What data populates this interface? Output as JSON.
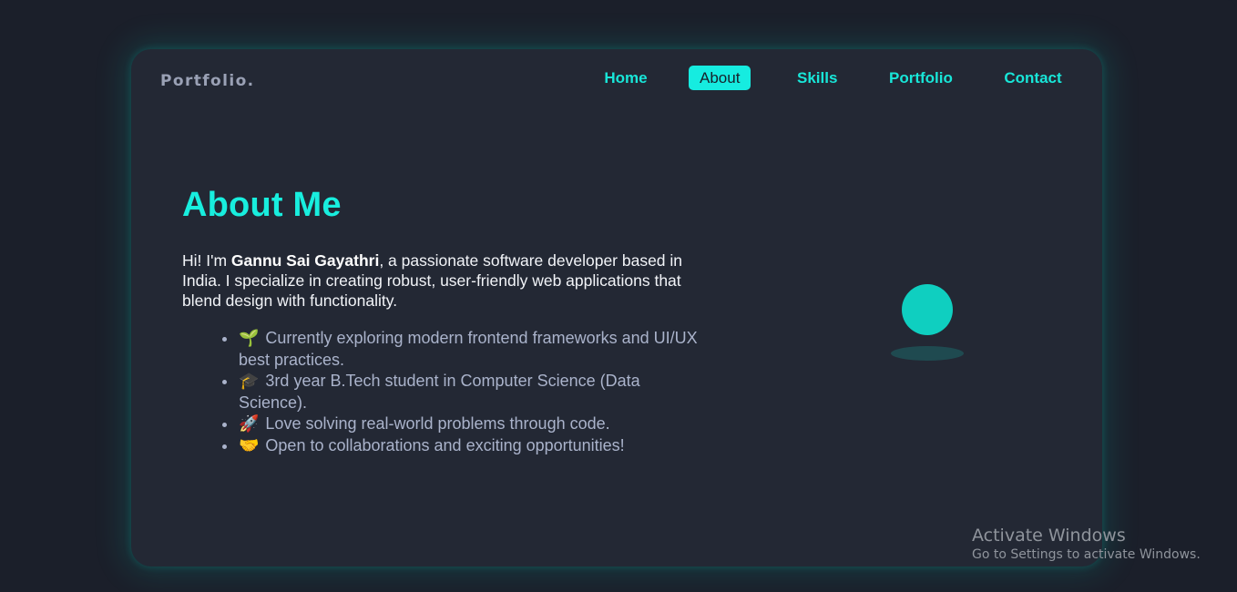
{
  "header": {
    "logo": "Portfolio.",
    "nav": [
      {
        "label": "Home"
      },
      {
        "label": "About"
      },
      {
        "label": "Skills"
      },
      {
        "label": "Portfolio"
      },
      {
        "label": "Contact"
      }
    ],
    "active_nav": "About"
  },
  "about": {
    "title": "About Me",
    "intro_prefix": "Hi! I'm ",
    "name": "Gannu Sai Gayathri",
    "intro_suffix": ", a passionate software developer based in India. I specialize in creating robust, user-friendly web applications that blend design with functionality.",
    "points": [
      {
        "emoji": "🌱",
        "icon": "seedling-icon",
        "text": "Currently exploring modern frontend frameworks and UI/UX best practices."
      },
      {
        "emoji": "🎓",
        "icon": "graduation-cap-icon",
        "text": "3rd year B.Tech student in Computer Science (Data Science)."
      },
      {
        "emoji": "🚀",
        "icon": "rocket-icon",
        "text": "Love solving real-world problems through code."
      },
      {
        "emoji": "🤝",
        "icon": "handshake-icon",
        "text": "Open to collaborations and exciting opportunities!"
      }
    ]
  },
  "watermark": {
    "title": "Activate Windows",
    "subtitle": "Go to Settings to activate Windows."
  },
  "colors": {
    "accent": "#18e6d8",
    "background": "#1b1f2a",
    "card": "#232834",
    "text": "#f2f4f8",
    "muted_text": "#aab3cb"
  }
}
